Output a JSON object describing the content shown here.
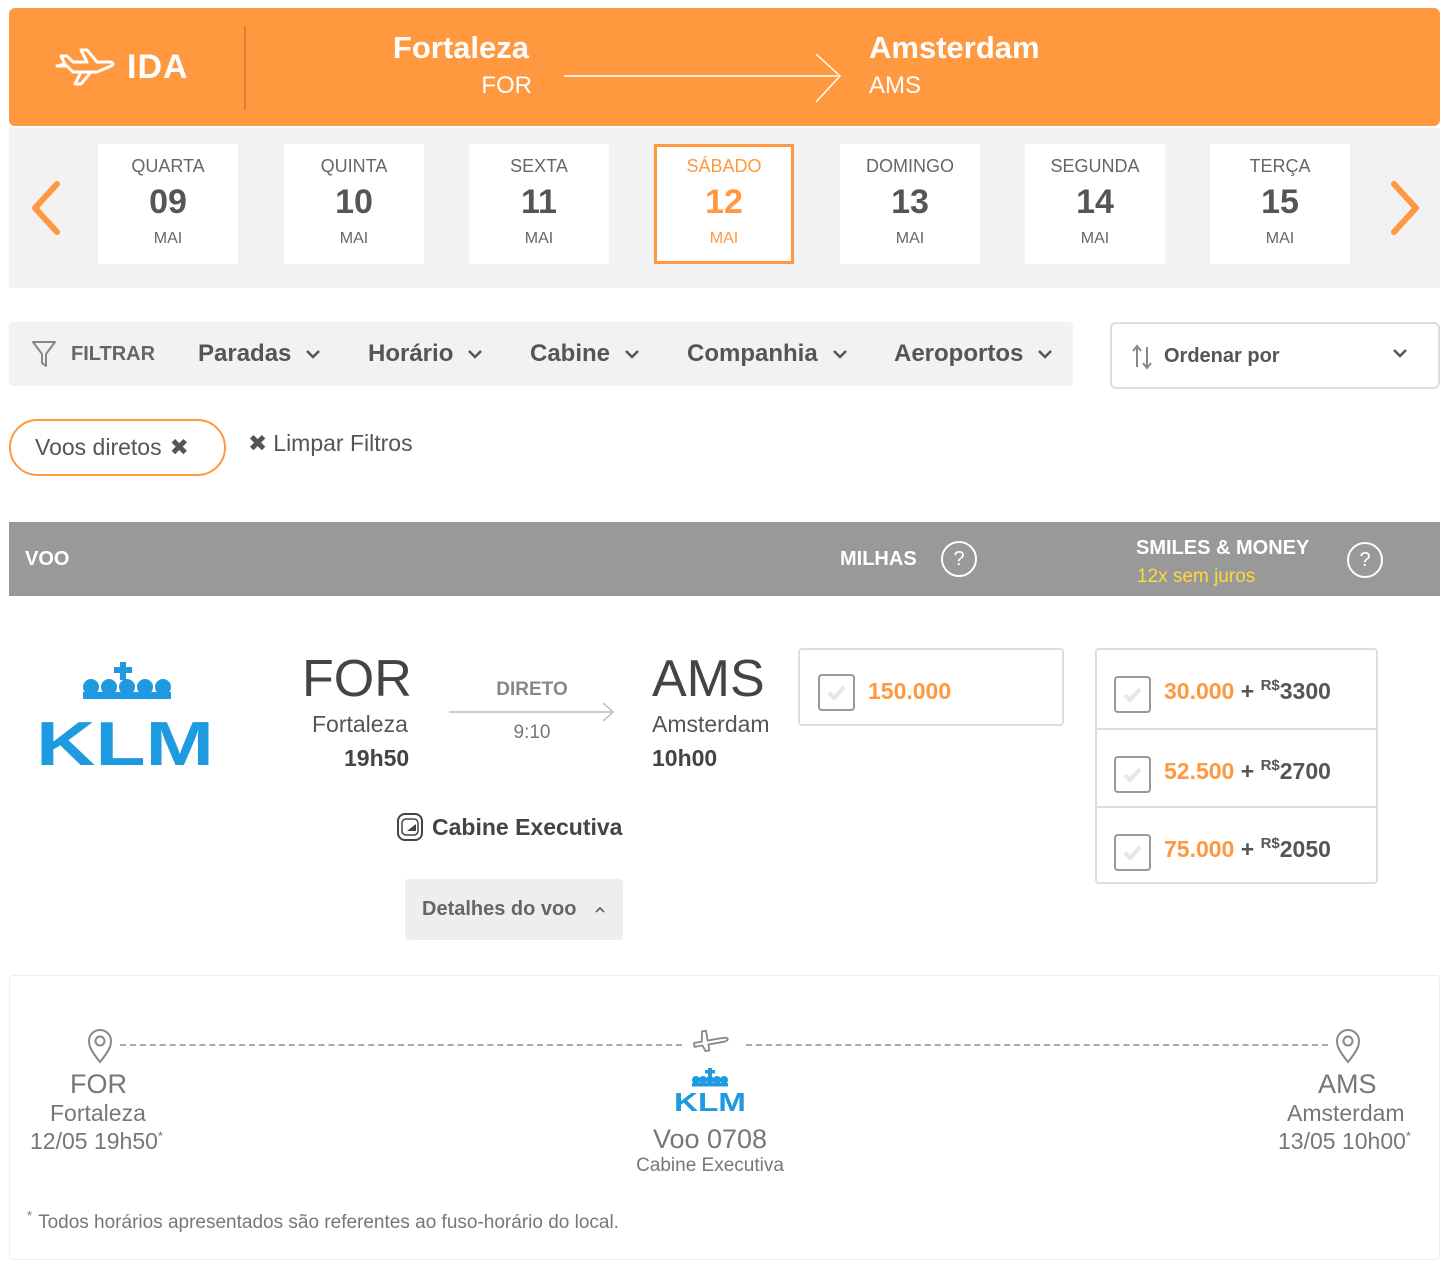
{
  "route": {
    "direction_label": "IDA",
    "origin_city": "Fortaleza",
    "origin_code": "FOR",
    "destination_city": "Amsterdam",
    "destination_code": "AMS"
  },
  "dates": [
    {
      "weekday": "QUARTA",
      "day": "09",
      "month": "MAI",
      "selected": false
    },
    {
      "weekday": "QUINTA",
      "day": "10",
      "month": "MAI",
      "selected": false
    },
    {
      "weekday": "SEXTA",
      "day": "11",
      "month": "MAI",
      "selected": false
    },
    {
      "weekday": "SÁBADO",
      "day": "12",
      "month": "MAI",
      "selected": true
    },
    {
      "weekday": "DOMINGO",
      "day": "13",
      "month": "MAI",
      "selected": false
    },
    {
      "weekday": "SEGUNDA",
      "day": "14",
      "month": "MAI",
      "selected": false
    },
    {
      "weekday": "TERÇA",
      "day": "15",
      "month": "MAI",
      "selected": false
    }
  ],
  "filters": {
    "label": "FILTRAR",
    "items": [
      "Paradas",
      "Horário",
      "Cabine",
      "Companhia",
      "Aeroportos"
    ],
    "sort_label": "Ordenar por"
  },
  "active_filters": {
    "chip_label": "Voos diretos",
    "clear_label": "Limpar Filtros"
  },
  "table_header": {
    "flight": "VOO",
    "miles": "MILHAS",
    "smiles_money": "SMILES & MONEY",
    "installments": "12x sem juros",
    "help": "?"
  },
  "flight": {
    "airline": "KLM",
    "origin_code": "FOR",
    "origin_city": "Fortaleza",
    "departure_time": "19h50",
    "stops_label": "DIRETO",
    "duration": "9:10",
    "destination_code": "AMS",
    "destination_city": "Amsterdam",
    "arrival_time": "10h00",
    "cabin": "Cabine Executiva",
    "details_label": "Detalhes do voo",
    "miles_price": "150.000",
    "combos": [
      {
        "miles": "30.000",
        "plus": "+",
        "currency": "R$",
        "money": "3300"
      },
      {
        "miles": "52.500",
        "plus": "+",
        "currency": "R$",
        "money": "2700"
      },
      {
        "miles": "75.000",
        "plus": "+",
        "currency": "R$",
        "money": "2050"
      }
    ]
  },
  "details": {
    "origin_code": "FOR",
    "origin_city": "Fortaleza",
    "origin_datetime": "12/05 19h50",
    "destination_code": "AMS",
    "destination_city": "Amsterdam",
    "destination_datetime": "13/05 10h00",
    "flight_number": "Voo 0708",
    "cabin": "Cabine Executiva",
    "asterisk": "*",
    "note": "Todos horários apresentados são referentes ao fuso-horário do local."
  },
  "colors": {
    "accent": "#ff983f",
    "header_gray": "#999999",
    "klm_blue": "#1e9ae0",
    "installments_yellow": "#ffd83a"
  },
  "icons": {
    "route": "plane-icon",
    "date_prev": "chevron-left-icon",
    "date_next": "chevron-right-icon",
    "filter": "filter-funnel-icon",
    "sort": "sort-arrows-icon",
    "cabin": "seat-icon",
    "location": "map-pin-icon"
  }
}
